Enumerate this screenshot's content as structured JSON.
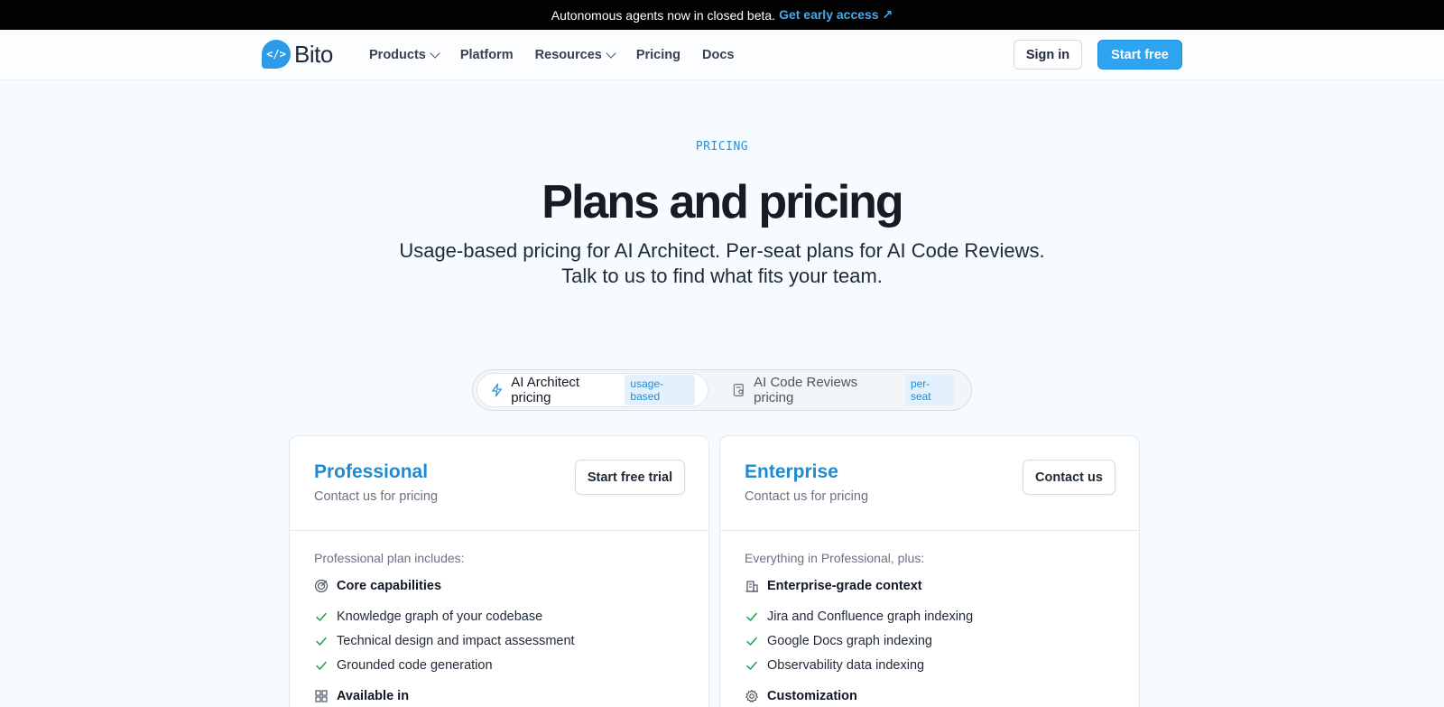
{
  "announcement": {
    "text": "Autonomous agents now in closed beta.",
    "link": "Get early access ↗"
  },
  "nav": {
    "logo_text": "Bito",
    "logo_glyph": "</>",
    "items": [
      {
        "label": "Products",
        "dropdown": true
      },
      {
        "label": "Platform",
        "dropdown": false
      },
      {
        "label": "Resources",
        "dropdown": true
      },
      {
        "label": "Pricing",
        "dropdown": false
      },
      {
        "label": "Docs",
        "dropdown": false
      }
    ],
    "signin": "Sign in",
    "start_free": "Start free"
  },
  "hero": {
    "eyebrow": "PRICING",
    "title": "Plans and pricing",
    "sub1": "Usage-based pricing for AI Architect. Per-seat plans for AI Code Reviews.",
    "sub2": "Talk to us to find what fits your team."
  },
  "toggle": {
    "options": [
      {
        "label": "AI Architect pricing",
        "tag": "usage-based",
        "icon": "lightning-icon",
        "active": true
      },
      {
        "label": "AI Code Reviews pricing",
        "tag": "per-seat",
        "icon": "code-review-icon",
        "active": false
      }
    ]
  },
  "plans": [
    {
      "name": "Professional",
      "price": "Contact us for pricing",
      "button": "Start free trial",
      "includes": "Professional plan includes:",
      "group_title": "Core capabilities",
      "group_icon": "target-icon",
      "features": [
        "Knowledge graph of your codebase",
        "Technical design and impact assessment",
        "Grounded code generation"
      ],
      "group2_title": "Available in",
      "group2_icon": "grid-icon"
    },
    {
      "name": "Enterprise",
      "price": "Contact us for pricing",
      "button": "Contact us",
      "includes": "Everything in Professional, plus:",
      "group_title": "Enterprise-grade context",
      "group_icon": "building-icon",
      "features": [
        "Jira and Confluence graph indexing",
        "Google Docs graph indexing",
        "Observability data indexing"
      ],
      "group2_title": "Customization",
      "group2_icon": "gear-icon"
    }
  ],
  "colors": {
    "accent": "#2ea3ef",
    "plan_name": "#1d8bd1",
    "check": "#16a34a",
    "background": "#f5fbff"
  }
}
